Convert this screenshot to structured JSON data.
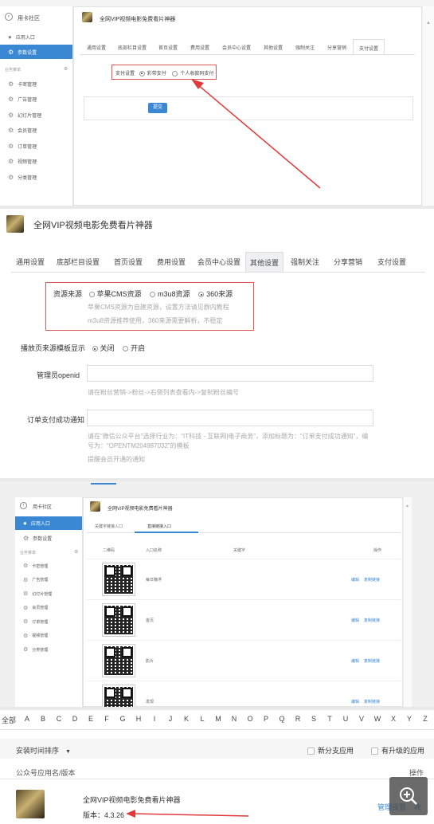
{
  "p1": {
    "sidebar_title": "用卡社区",
    "sidebar_items": [
      {
        "label": "应用入口"
      },
      {
        "label": "参数设置",
        "active": true
      }
    ],
    "business_label": "业务菜单",
    "business_items": [
      "卡密管理",
      "广告管理",
      "幻灯片管理",
      "会员管理",
      "订单管理",
      "视频管理",
      "分类管理"
    ],
    "app_title": "全网VIP视频电影免费看片神器",
    "tabs": [
      "通用设置",
      "底部栏目设置",
      "首页设置",
      "费用设置",
      "会员中心设置",
      "其他设置",
      "强制关注",
      "分享营销",
      "支付设置"
    ],
    "selected_tab": "支付设置",
    "pay_label": "支付设置",
    "pay_options": [
      "彩带支付",
      "个人收款码支付"
    ],
    "submit": "提交"
  },
  "p2": {
    "app_title": "全网VIP视频电影免费看片神器",
    "tabs": [
      "通用设置",
      "底部栏目设置",
      "首页设置",
      "费用设置",
      "会员中心设置",
      "其他设置",
      "强制关注",
      "分享营销",
      "支付设置"
    ],
    "selected_tab": "其他设置",
    "source_label": "资源来源",
    "source_options": [
      "苹果CMS资源",
      "m3u8资源",
      "360来源"
    ],
    "source_hint1": "苹果CMS资源为自建资源，设置方法请见群内教程",
    "source_hint2": "m3u8资源推荐使用，360来源需要解析，不稳定",
    "display_label": "播放页来源模板显示",
    "display_options": [
      "关闭",
      "开启"
    ],
    "openid_label": "管理员openid",
    "openid_hint": "请在粉丝营销->粉丝->右侧列表查看内->复制粉丝编号",
    "notify_label": "订单支付成功通知",
    "notify_hint": "请在“微信公众平台”选择行业为：“IT科技 - 互联网|电子商务”，添加标题为：“订单支付成功通知”，编号为：“OPENTM204987032”的模板",
    "notify_hint2": "提醒会员开通的通知"
  },
  "p3": {
    "sidebar_title": "用卡社区",
    "sidebar_items": [
      {
        "label": "应用入口",
        "active": true
      },
      {
        "label": "参数设置"
      }
    ],
    "business_label": "业务菜单",
    "business_items": [
      "卡密管理",
      "广告管理",
      "幻灯片管理",
      "会员管理",
      "订单管理",
      "视频管理",
      "分类管理"
    ],
    "app_title": "全网VIP视频电影免费看片神器",
    "tabs": [
      "关键字链接入口",
      "直接链接入口"
    ],
    "columns": [
      "二维码",
      "入口名称",
      "关键字",
      "操作"
    ],
    "rows": [
      {
        "name": "每日赚浮",
        "edit": "编辑",
        "copy": "复制链接"
      },
      {
        "name": "首页",
        "edit": "编辑",
        "copy": "复制链接"
      },
      {
        "name": "影片",
        "edit": "编辑",
        "copy": "复制链接"
      },
      {
        "name": "发现",
        "edit": "编辑",
        "copy": "复制链接"
      }
    ]
  },
  "p4": {
    "alphabet": [
      "全部",
      "A",
      "B",
      "C",
      "D",
      "E",
      "F",
      "G",
      "H",
      "I",
      "J",
      "K",
      "L",
      "M",
      "N",
      "O",
      "P",
      "Q",
      "R",
      "S",
      "T",
      "U",
      "V",
      "W",
      "X",
      "Y",
      "Z"
    ],
    "sort_label": "安装时间排序",
    "filter1": "新分支应用",
    "filter2": "有升级的应用",
    "col_name": "公众号应用名/版本",
    "col_action": "操作",
    "app_name": "全网VIP视频电影免费看片神器",
    "version": "版本：4.3.26",
    "manage": "管理设置",
    "more": "收"
  },
  "colors": {
    "accent": "#3a87d4",
    "highlight": "#e25555"
  }
}
